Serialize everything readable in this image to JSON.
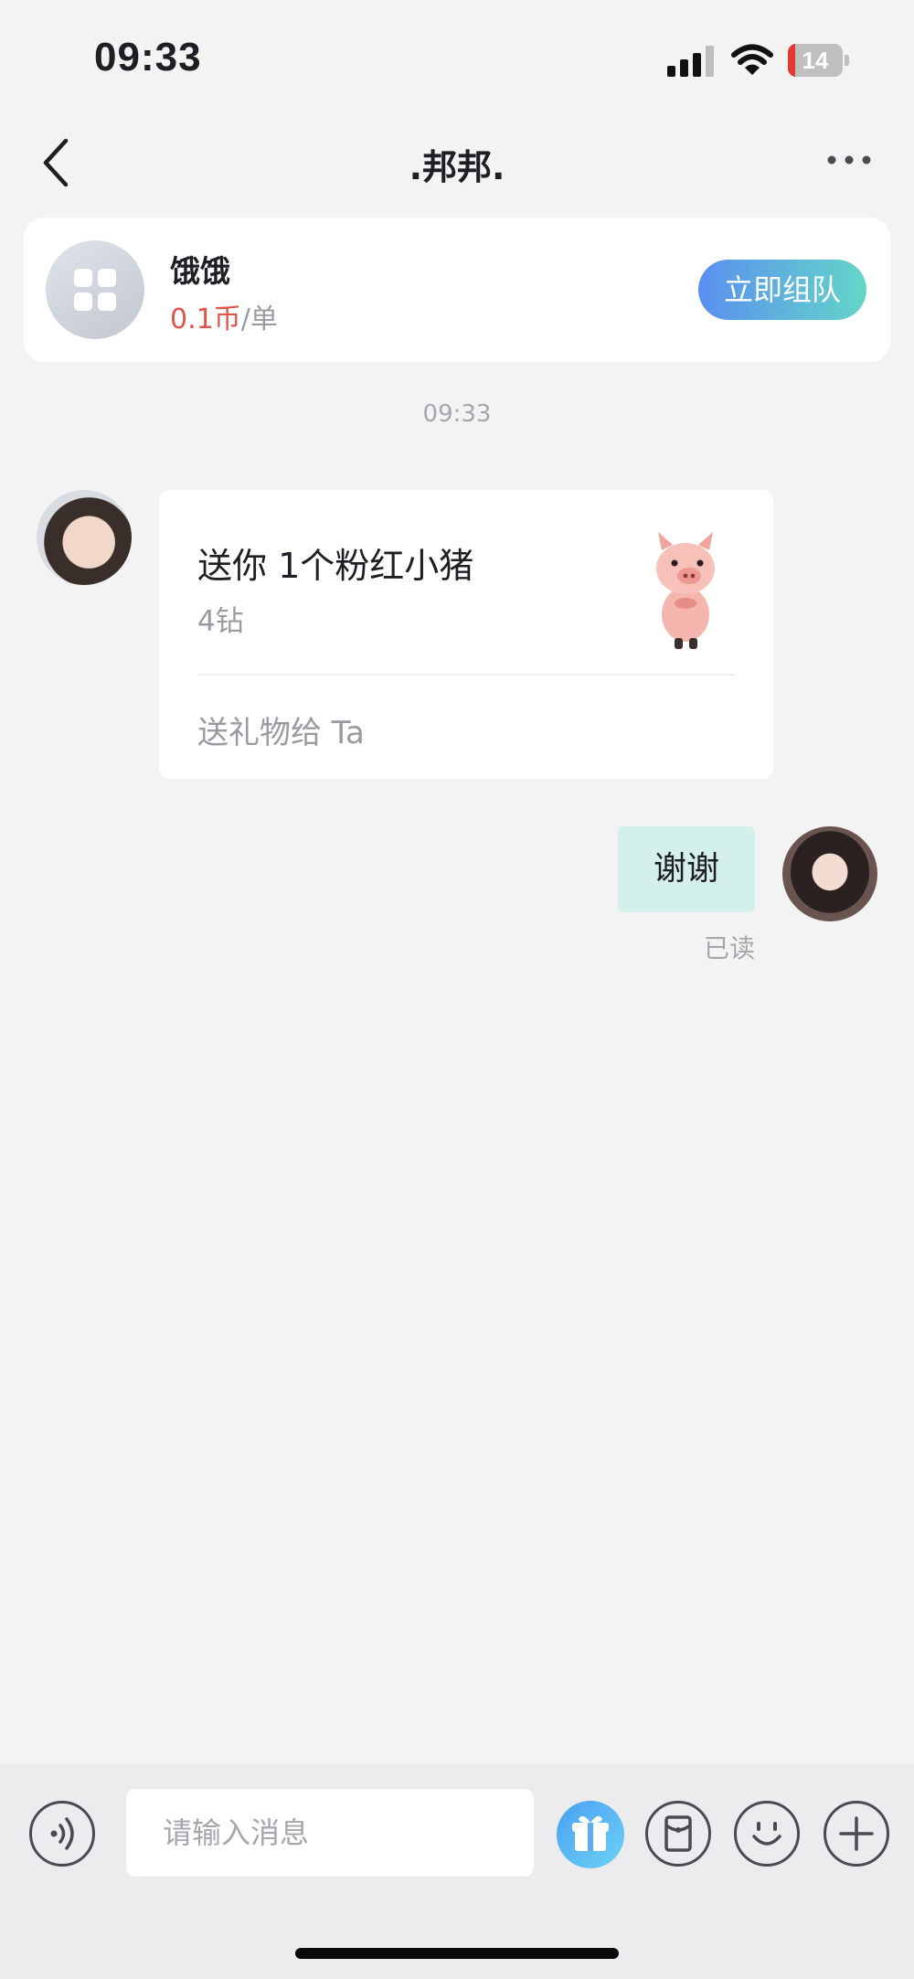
{
  "status_bar": {
    "time": "09:33",
    "battery_level": "14",
    "icons": [
      "cellular-signal-icon",
      "wifi-icon",
      "battery-icon"
    ]
  },
  "header": {
    "title": ".邦邦.",
    "icons": [
      "back-arrow-icon",
      "more-icon"
    ]
  },
  "order_card": {
    "service_name": "饿饿",
    "price_value": "0.1币",
    "price_unit": "/单",
    "action_label": "立即组队",
    "icon": "grid-apps-icon"
  },
  "chat": {
    "timestamp": "09:33",
    "gift_message": {
      "title": "送你 1个粉红小猪",
      "price": "4钻",
      "action_label": "送礼物给 Ta",
      "icon": "pink-pig-icon"
    },
    "outgoing_message": {
      "text": "谢谢",
      "status": "已读"
    }
  },
  "input_bar": {
    "placeholder": "请输入消息",
    "icons": [
      "voice-icon",
      "gift-icon",
      "red-packet-icon",
      "emoji-icon",
      "plus-icon"
    ]
  },
  "colors": {
    "background": "#f3f3f4",
    "price_red": "#e0554a",
    "button_gradient_start": "#5a8ff0",
    "button_gradient_end": "#63d6c8",
    "bubble_mint": "#d4f0ea"
  }
}
